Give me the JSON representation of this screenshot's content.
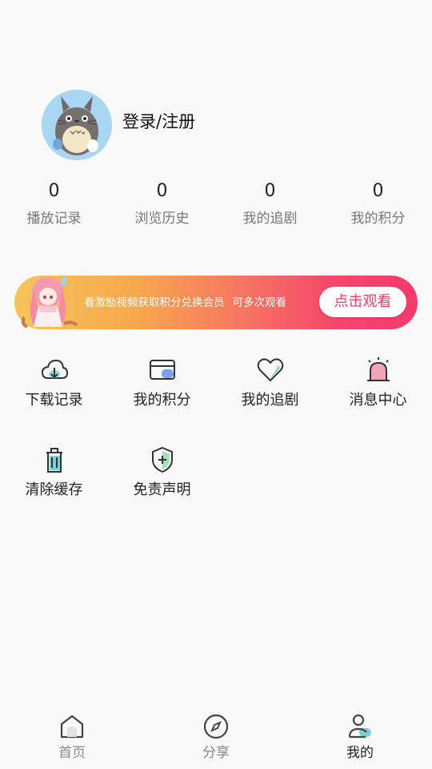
{
  "profile": {
    "login_label": "登录/注册"
  },
  "stats": [
    {
      "value": "0",
      "label": "播放记录"
    },
    {
      "value": "0",
      "label": "浏览历史"
    },
    {
      "value": "0",
      "label": "我的追剧"
    },
    {
      "value": "0",
      "label": "我的积分"
    }
  ],
  "banner": {
    "text": "看激励视频获取积分兑换会员",
    "subtext": "可多次观看",
    "button": "点击观看",
    "colors": {
      "start": "#f6c45a",
      "end": "#f53a6e",
      "button_text": "#ee3f63"
    }
  },
  "menu": [
    {
      "label": "下载记录",
      "icon": "cloud-download-icon"
    },
    {
      "label": "我的积分",
      "icon": "card-icon"
    },
    {
      "label": "我的追剧",
      "icon": "heart-icon"
    },
    {
      "label": "消息中心",
      "icon": "alarm-bell-icon"
    },
    {
      "label": "清除缓存",
      "icon": "trash-icon"
    },
    {
      "label": "免责声明",
      "icon": "shield-icon"
    }
  ],
  "nav": [
    {
      "label": "首页",
      "icon": "home-icon"
    },
    {
      "label": "分享",
      "icon": "compass-icon"
    },
    {
      "label": "我的",
      "icon": "user-icon",
      "active": true
    }
  ],
  "accent_colors": {
    "teal": "#7ad1d4",
    "blue": "#7f9df0",
    "green": "#8fd9a8",
    "pink": "#f4a3b4"
  }
}
